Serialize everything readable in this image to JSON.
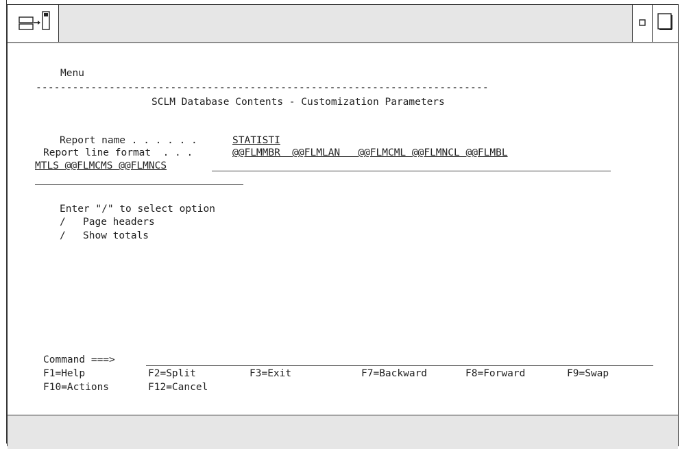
{
  "panel": {
    "menu_label": "Menu",
    "divider": "--------------------------------------------------------------------------",
    "title": "SCLM Database Contents - Customization Parameters",
    "report_name_label": "Report name . . . . . . ",
    "report_name_value": "STATISTI",
    "report_line_label": "Report line format  . . . ",
    "report_line_value_1": "@@FLMMBR  @@FLMLAN   @@FLMCML @@FLMNCL @@FLMBL",
    "report_line_value_2": "MTLS @@FLMCMS @@FLMNCS",
    "options_prompt": "Enter \"/\" to select option",
    "options": [
      {
        "mark": "/",
        "label": "Page headers"
      },
      {
        "mark": "/",
        "label": "Show totals"
      }
    ]
  },
  "command": {
    "label": "Command ===> ",
    "value": ""
  },
  "function_keys": {
    "row1": [
      {
        "key": "F1=Help"
      },
      {
        "key": "F2=Split"
      },
      {
        "key": "F3=Exit"
      },
      {
        "key": "F7=Backward"
      },
      {
        "key": "F8=Forward"
      },
      {
        "key": "F9=Swap"
      }
    ],
    "row2": [
      {
        "key": "F10=Actions"
      },
      {
        "key": "F12=Cancel"
      }
    ]
  },
  "icons": {
    "system_menu": "window-menu-icon",
    "minimize": "minimize-icon",
    "maximize": "maximize-icon"
  }
}
